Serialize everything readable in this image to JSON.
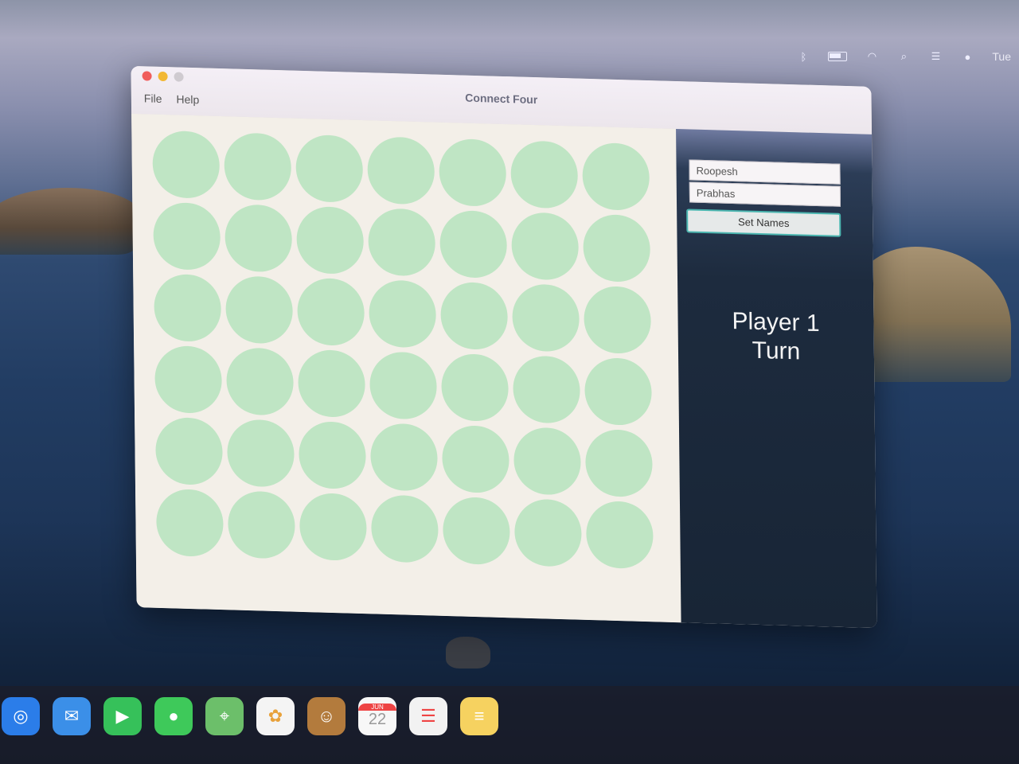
{
  "window": {
    "title": "Connect Four",
    "menu": [
      "File",
      "Help"
    ]
  },
  "board": {
    "rows": 6,
    "columns": 7,
    "empty_color": "#bfe5c4"
  },
  "sidebar": {
    "player1_name": "Roopesh",
    "player2_name": "Prabhas",
    "set_names_label": "Set Names",
    "turn_line1": "Player 1",
    "turn_line2": "Turn"
  },
  "menubar": {
    "clock": "Tue"
  },
  "dock": {
    "calendar_month": "JUN",
    "calendar_day": "22",
    "icons": [
      "safari-icon",
      "mail-icon",
      "facetime-icon",
      "messages-icon",
      "maps-icon",
      "photos-icon",
      "contacts-icon",
      "calendar-icon",
      "reminders-icon",
      "notes-icon"
    ]
  }
}
